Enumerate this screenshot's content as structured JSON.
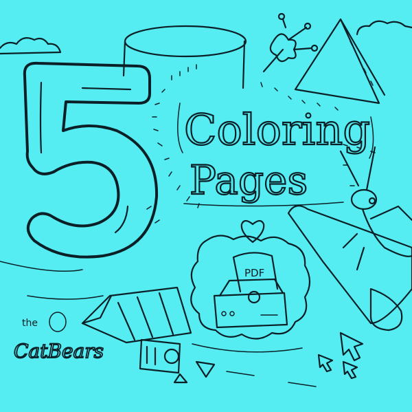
{
  "title": {
    "number": "5",
    "line1": "Coloring",
    "line2": "Pages"
  },
  "logo": {
    "small": "the",
    "brand": "CatBears"
  },
  "printer_page": {
    "label": "PDF"
  },
  "colors": {
    "background": "#55ecf2",
    "ink": "#0b1f26"
  },
  "icons": [
    "heart-icon",
    "printer-icon",
    "pencil-icon",
    "cursor-icon",
    "camera-icon",
    "cricket-icon",
    "flower-icon",
    "cloud-icon"
  ]
}
